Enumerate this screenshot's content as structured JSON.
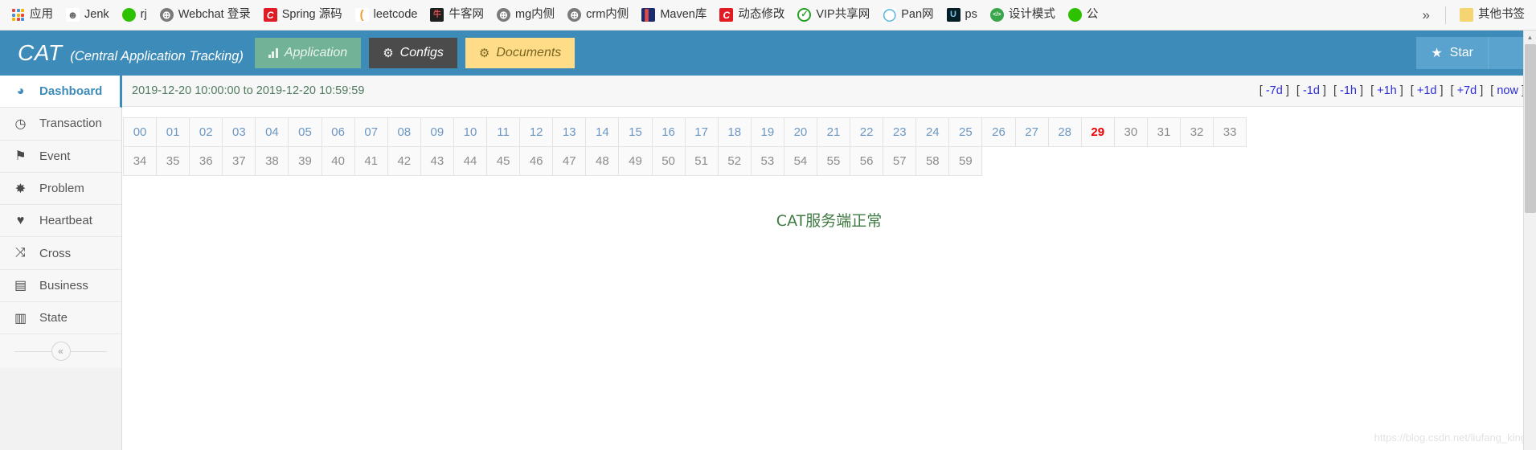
{
  "browser": {
    "bookmarks": [
      {
        "label": "应用",
        "icon": "apps-grid-icon",
        "color": "#4a90d9"
      },
      {
        "label": "Jenk",
        "icon": "jenkins-icon",
        "color": "#6b6b6b"
      },
      {
        "label": "rj",
        "icon": "wechat-icon",
        "color": "#2dc100"
      },
      {
        "label": "Webchat 登录",
        "icon": "globe-icon",
        "color": "#7a7a7a"
      },
      {
        "label": "Spring 源码",
        "icon": "c-red-icon",
        "color": "#e01b24"
      },
      {
        "label": "leetcode",
        "icon": "leetcode-icon",
        "color": "#f0a030"
      },
      {
        "label": "牛客网",
        "icon": "nowcoder-icon",
        "color": "#1f1f1f"
      },
      {
        "label": "mg内侧",
        "icon": "globe-icon",
        "color": "#7a7a7a"
      },
      {
        "label": "crm内侧",
        "icon": "globe-icon",
        "color": "#7a7a7a"
      },
      {
        "label": "Maven库",
        "icon": "maven-icon",
        "color": "#1c2b6b"
      },
      {
        "label": "动态修改",
        "icon": "c-red-icon",
        "color": "#e01b24"
      },
      {
        "label": "VIP共享网",
        "icon": "check-green-icon",
        "color": "#25a025"
      },
      {
        "label": "Pan网",
        "icon": "pan-cloud-icon",
        "color": "#5bb8e0"
      },
      {
        "label": "ps",
        "icon": "photoshop-icon",
        "color": "#061e26"
      },
      {
        "label": "设计模式",
        "icon": "code-green-icon",
        "color": "#3aa64c"
      },
      {
        "label": "公",
        "icon": "wechat-icon",
        "color": "#2dc100"
      }
    ],
    "overflow_label": "»",
    "other_bookmarks": {
      "label": "其他书签",
      "icon": "folder-icon",
      "color": "#f5d571"
    }
  },
  "header": {
    "logo": "CAT",
    "subtitle": "(Central Application Tracking)",
    "tabs": [
      {
        "label": "Application",
        "icon": "bar-chart-icon",
        "style": "green"
      },
      {
        "label": "Configs",
        "icon": "gears-icon",
        "style": "dark"
      },
      {
        "label": "Documents",
        "icon": "gears-icon",
        "style": "yellow"
      }
    ],
    "star_button": {
      "label": "Star",
      "icon": "star-icon"
    },
    "bg_color": "#3d8bb8"
  },
  "sidebar": {
    "items": [
      {
        "label": "Dashboard",
        "icon": "dashboard-gauge-icon",
        "active": true
      },
      {
        "label": "Transaction",
        "icon": "clock-icon",
        "active": false
      },
      {
        "label": "Event",
        "icon": "flag-icon",
        "active": false
      },
      {
        "label": "Problem",
        "icon": "bug-icon",
        "active": false
      },
      {
        "label": "Heartbeat",
        "icon": "heart-icon",
        "active": false
      },
      {
        "label": "Cross",
        "icon": "shuffle-icon",
        "active": false
      },
      {
        "label": "Business",
        "icon": "list-icon",
        "active": false
      },
      {
        "label": "State",
        "icon": "bar-chart-icon",
        "active": false
      }
    ],
    "collapse_icon": "chevron-double-left-icon",
    "active_color": "#3d8bb8"
  },
  "main": {
    "time_range": "2019-12-20 10:00:00 to 2019-12-20 10:59:59",
    "shortcuts": [
      {
        "label": "-7d"
      },
      {
        "label": "-1d"
      },
      {
        "label": "-1h"
      },
      {
        "label": "+1h"
      },
      {
        "label": "+1d"
      },
      {
        "label": "+7d"
      },
      {
        "label": "now"
      }
    ],
    "minute_grid": {
      "row1": [
        {
          "label": "00",
          "state": "link"
        },
        {
          "label": "01",
          "state": "link"
        },
        {
          "label": "02",
          "state": "link"
        },
        {
          "label": "03",
          "state": "link"
        },
        {
          "label": "04",
          "state": "link"
        },
        {
          "label": "05",
          "state": "link"
        },
        {
          "label": "06",
          "state": "link"
        },
        {
          "label": "07",
          "state": "link"
        },
        {
          "label": "08",
          "state": "link"
        },
        {
          "label": "09",
          "state": "link"
        },
        {
          "label": "10",
          "state": "link"
        },
        {
          "label": "11",
          "state": "link"
        },
        {
          "label": "12",
          "state": "link"
        },
        {
          "label": "13",
          "state": "link"
        },
        {
          "label": "14",
          "state": "link"
        },
        {
          "label": "15",
          "state": "link"
        },
        {
          "label": "16",
          "state": "link"
        },
        {
          "label": "17",
          "state": "link"
        },
        {
          "label": "18",
          "state": "link"
        },
        {
          "label": "19",
          "state": "link"
        },
        {
          "label": "20",
          "state": "link"
        },
        {
          "label": "21",
          "state": "link"
        },
        {
          "label": "22",
          "state": "link"
        },
        {
          "label": "23",
          "state": "link"
        },
        {
          "label": "24",
          "state": "link"
        },
        {
          "label": "25",
          "state": "link"
        },
        {
          "label": "26",
          "state": "link"
        },
        {
          "label": "27",
          "state": "link"
        },
        {
          "label": "28",
          "state": "link"
        },
        {
          "label": "29",
          "state": "current"
        },
        {
          "label": "30",
          "state": "disabled"
        },
        {
          "label": "31",
          "state": "disabled"
        },
        {
          "label": "32",
          "state": "disabled"
        },
        {
          "label": "33",
          "state": "disabled"
        }
      ],
      "row2": [
        {
          "label": "34",
          "state": "disabled"
        },
        {
          "label": "35",
          "state": "disabled"
        },
        {
          "label": "36",
          "state": "disabled"
        },
        {
          "label": "37",
          "state": "disabled"
        },
        {
          "label": "38",
          "state": "disabled"
        },
        {
          "label": "39",
          "state": "disabled"
        },
        {
          "label": "40",
          "state": "disabled"
        },
        {
          "label": "41",
          "state": "disabled"
        },
        {
          "label": "42",
          "state": "disabled"
        },
        {
          "label": "43",
          "state": "disabled"
        },
        {
          "label": "44",
          "state": "disabled"
        },
        {
          "label": "45",
          "state": "disabled"
        },
        {
          "label": "46",
          "state": "disabled"
        },
        {
          "label": "47",
          "state": "disabled"
        },
        {
          "label": "48",
          "state": "disabled"
        },
        {
          "label": "49",
          "state": "disabled"
        },
        {
          "label": "50",
          "state": "disabled"
        },
        {
          "label": "51",
          "state": "disabled"
        },
        {
          "label": "52",
          "state": "disabled"
        },
        {
          "label": "53",
          "state": "disabled"
        },
        {
          "label": "54",
          "state": "disabled"
        },
        {
          "label": "55",
          "state": "disabled"
        },
        {
          "label": "56",
          "state": "disabled"
        },
        {
          "label": "57",
          "state": "disabled"
        },
        {
          "label": "58",
          "state": "disabled"
        },
        {
          "label": "59",
          "state": "disabled"
        }
      ]
    },
    "status_message": "CAT服务端正常",
    "status_color": "#3f7a43",
    "watermark": "https://blog.csdn.net/liufang_king"
  }
}
